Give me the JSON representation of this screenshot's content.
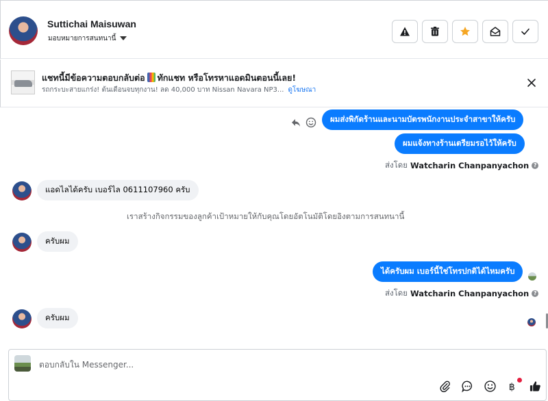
{
  "header": {
    "contact_name": "Suttichai Maisuwan",
    "assign_label": "มอบหมายการสนทนานี้",
    "actions": [
      {
        "name": "report-spam",
        "icon": "warning-icon"
      },
      {
        "name": "delete",
        "icon": "trash-icon"
      },
      {
        "name": "star",
        "icon": "star-icon",
        "color": "#f5a623"
      },
      {
        "name": "mark-unread",
        "icon": "envelope-open-icon"
      },
      {
        "name": "mark-done",
        "icon": "check-icon"
      }
    ]
  },
  "ad": {
    "title_part1": "แชทนี้มีข้อความตอบกลับต่อ",
    "title_part2": "ทักแชท หรือโทรหาแอดมินตอนนี้เลย!",
    "subtitle": "รถกระบะสายแกร่ง! ต้นเดือนจบทุกงาน! ลด 40,000 บาท Nissan Navara NP3...",
    "link": "ดูโฆษณา"
  },
  "messages": {
    "out1": "ผมส่งพิกัดร้านและนามบัตรพนักงานประจำสาขาให้ครับ",
    "out2": "ผมแจ้งทางร้านเตรียมรอไว้ให้ครับ",
    "sent_by_prefix": "ส่งโดย",
    "sent_by_name": "Watcharin Chanpanyachon",
    "in1": "แอดไลได้ครับ เบอร์ไล 0611107960  ครับ",
    "system": "เราสร้างกิจกรรมของลูกค้าเป้าหมายให้กับคุณโดยอัตโนมัติโดยอิงตามการสนทนานี้",
    "in2": "ครับผม",
    "out3": "ได้ครับผม เบอร์นี้ใช่โทรปกติได้ไหมครับ",
    "in3": "ครับผม"
  },
  "composer": {
    "placeholder": "ตอบกลับใน Messenger...",
    "tools": [
      "paperclip-icon",
      "chat-bubble-icon",
      "emoji-icon",
      "baht-payment-icon",
      "thumbs-up-icon"
    ]
  },
  "colors": {
    "outgoing_bubble": "#0a7cff",
    "incoming_bubble": "#f0f2f5",
    "link": "#1876f2"
  }
}
